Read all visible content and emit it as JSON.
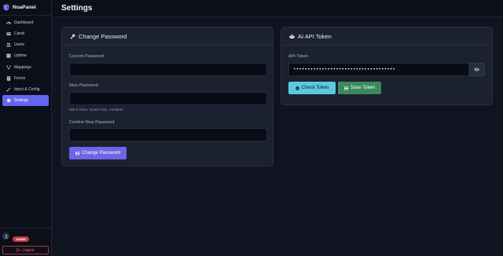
{
  "app": {
    "name": "NoaPanel"
  },
  "sidebar": {
    "items": [
      {
        "label": "Dashboard",
        "icon": "dashboard-icon",
        "active": false
      },
      {
        "label": "Cards",
        "icon": "card-icon",
        "active": false
      },
      {
        "label": "Users",
        "icon": "users-icon",
        "active": false
      },
      {
        "label": "Uptime",
        "icon": "server-icon",
        "active": false
      },
      {
        "label": "Mappings",
        "icon": "mapping-icon",
        "active": false
      },
      {
        "label": "Forms",
        "icon": "form-icon",
        "active": false
      },
      {
        "label": "Inject & Config",
        "icon": "wand-icon",
        "active": false
      },
      {
        "label": "Settings",
        "icon": "gear-icon",
        "active": true
      }
    ],
    "role_badge": "ADMIN",
    "logout_label": "Logout"
  },
  "header": {
    "title": "Settings"
  },
  "password_card": {
    "title": "Change Password",
    "icon": "key-icon",
    "current_label": "Current Password",
    "current_value": "",
    "new_label": "New Password",
    "new_value": "",
    "hint": "Min 8 chars, mixed case, numbers",
    "confirm_label": "Confirm New Password",
    "confirm_value": "",
    "submit_label": "Change Password"
  },
  "token_card": {
    "title": "AI API Token",
    "icon": "robot-icon",
    "token_label": "API Token",
    "token_value": "••••••••••••••••••••••••••••••••••••",
    "check_label": "Check Token",
    "save_label": "Save Token"
  },
  "colors": {
    "accent": "#6366f1",
    "info": "#5ac8e0",
    "success": "#3c8a5c",
    "danger": "#c03a3a"
  }
}
